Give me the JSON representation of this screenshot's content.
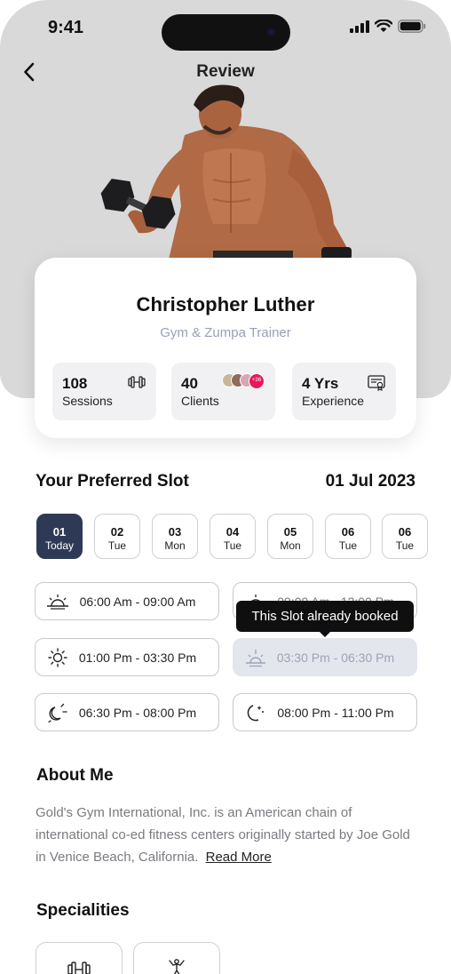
{
  "status_bar": {
    "time": "9:41"
  },
  "header": {
    "title": "Review"
  },
  "trainer": {
    "name": "Christopher Luther",
    "role": "Gym & Zumpa Trainer",
    "stats": [
      {
        "value": "108",
        "label": "Sessions",
        "icon": "dumbbell-icon"
      },
      {
        "value": "40",
        "label": "Clients",
        "icon": "client-avatars",
        "badge": "+36"
      },
      {
        "value": "4 Yrs",
        "label": "Experience",
        "icon": "certificate-icon"
      }
    ]
  },
  "preferred_slot": {
    "heading": "Your Preferred Slot",
    "date": "01 Jul 2023",
    "days": [
      {
        "day": "01",
        "label": "Today",
        "active": true
      },
      {
        "day": "02",
        "label": "Tue"
      },
      {
        "day": "03",
        "label": "Mon"
      },
      {
        "day": "04",
        "label": "Tue"
      },
      {
        "day": "05",
        "label": "Mon"
      },
      {
        "day": "06",
        "label": "Tue"
      },
      {
        "day": "06",
        "label": "Tue"
      }
    ],
    "slots": [
      {
        "time": "06:00 Am - 09:00 Am",
        "icon": "sunrise-icon"
      },
      {
        "time": "09:00 Am - 12:00 Pm",
        "icon": "sunrise-icon"
      },
      {
        "time": "01:00 Pm - 03:30 Pm",
        "icon": "sun-icon"
      },
      {
        "time": "03:30 Pm - 06:30 Pm",
        "icon": "sunset-icon",
        "booked": true
      },
      {
        "time": "06:30 Pm - 08:00 Pm",
        "icon": "moon-sun-icon"
      },
      {
        "time": "08:00 Pm - 11:00 Pm",
        "icon": "moon-stars-icon"
      }
    ],
    "tooltip": "This Slot already booked"
  },
  "about": {
    "heading": "About Me",
    "text": "Gold's Gym International, Inc. is an American chain of international co-ed fitness centers originally started by Joe Gold in Venice Beach, California.",
    "read_more": "Read More"
  },
  "specialities": {
    "heading": "Specialities",
    "items": [
      {
        "icon": "dumbbell-icon"
      },
      {
        "icon": "zumba-dancer-icon"
      }
    ]
  },
  "colors": {
    "active_day": "#2e3a55",
    "booked_slot": "#e4e6ee",
    "hero_bg": "#d9d9d9",
    "role_text": "#9aa0b4",
    "client_badge": "#e6195c"
  }
}
